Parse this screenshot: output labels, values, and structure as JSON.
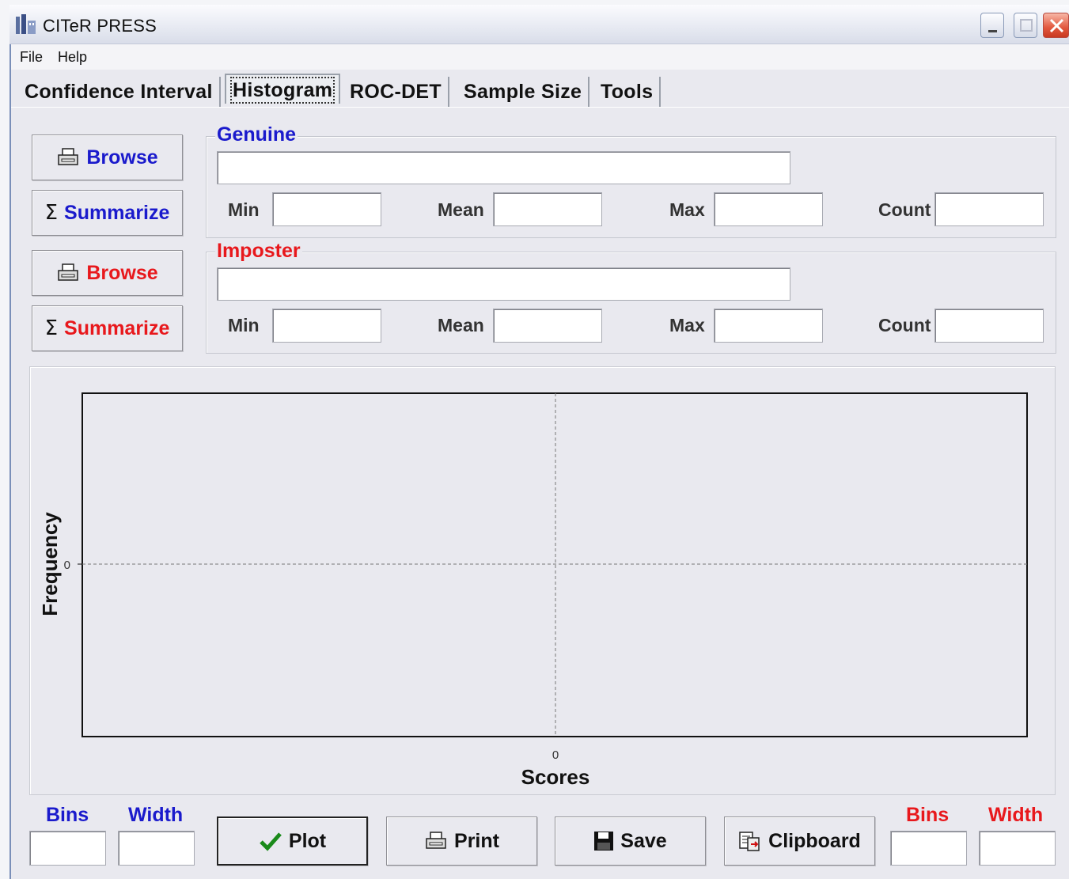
{
  "window": {
    "title": "CITeR PRESS"
  },
  "menu": [
    "File",
    "Help"
  ],
  "tabs": [
    "Confidence Interval",
    "Histogram",
    "ROC-DET",
    "Sample Size",
    "Tools"
  ],
  "active_tab": "Histogram",
  "genuine": {
    "title": "Genuine",
    "browse_label": "Browse",
    "summarize_label": "Summarize",
    "path_value": "",
    "stats_labels": {
      "min": "Min",
      "mean": "Mean",
      "max": "Max",
      "count": "Count"
    },
    "stats_values": {
      "min": "",
      "mean": "",
      "max": "",
      "count": ""
    },
    "color": "#1a1acc"
  },
  "imposter": {
    "title": "Imposter",
    "browse_label": "Browse",
    "summarize_label": "Summarize",
    "path_value": "",
    "stats_labels": {
      "min": "Min",
      "mean": "Mean",
      "max": "Max",
      "count": "Count"
    },
    "stats_values": {
      "min": "",
      "mean": "",
      "max": "",
      "count": ""
    },
    "color": "#e8181c"
  },
  "chart_data": {
    "type": "bar",
    "title": "",
    "xlabel": "Scores",
    "ylabel": "Frequency",
    "x_ticks": [
      "0"
    ],
    "y_ticks": [
      "0"
    ],
    "series": [],
    "grid": true
  },
  "bottom": {
    "genuine_bins_label": "Bins",
    "genuine_width_label": "Width",
    "imposter_bins_label": "Bins",
    "imposter_width_label": "Width",
    "genuine_bins_value": "",
    "genuine_width_value": "",
    "imposter_bins_value": "",
    "imposter_width_value": "",
    "plot_label": "Plot",
    "print_label": "Print",
    "save_label": "Save",
    "clipboard_label": "Clipboard"
  },
  "icons": {
    "browse": "printer-doc-icon",
    "summarize": "sigma-icon",
    "plot": "checkmark-icon",
    "print": "printer-icon",
    "save": "floppy-disk-icon",
    "clipboard": "clipboard-icon"
  }
}
